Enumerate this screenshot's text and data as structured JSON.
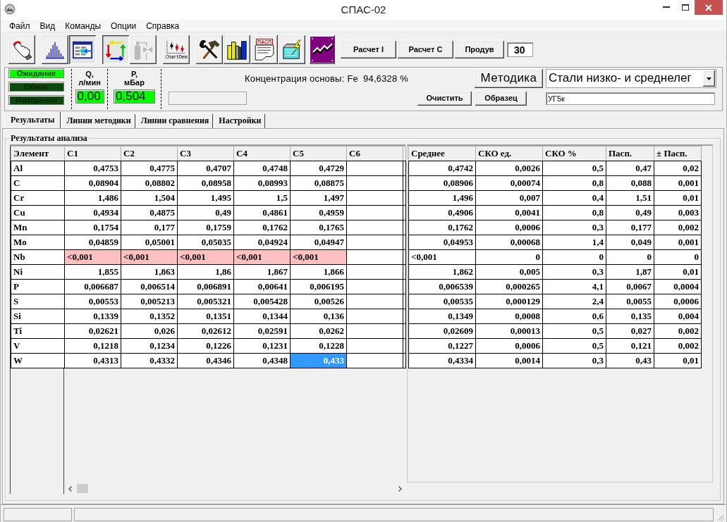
{
  "window": {
    "title": "СПАС-02"
  },
  "menu": [
    "Файл",
    "Вид",
    "Команды",
    "Опции",
    "Справка"
  ],
  "toolbar": {
    "groups": [
      [
        {
          "kind": "hand",
          "pressed": false,
          "disabled": false
        }
      ],
      [
        {
          "kind": "histogram",
          "pressed": false,
          "disabled": false
        },
        {
          "kind": "table",
          "pressed": true,
          "disabled": false
        }
      ],
      [
        {
          "kind": "arrows",
          "pressed": true,
          "disabled": false
        },
        {
          "kind": "cylinder",
          "pressed": false,
          "disabled": true
        }
      ],
      [
        {
          "kind": "chart",
          "caption": "ChartDem",
          "pressed": false,
          "disabled": false
        }
      ],
      [
        {
          "kind": "tools",
          "pressed": false,
          "disabled": false
        },
        {
          "kind": "books",
          "pressed": false,
          "disabled": false
        },
        {
          "kind": "document",
          "caption": "ПАСП",
          "pressed": false,
          "disabled": false
        },
        {
          "kind": "box",
          "pressed": false,
          "disabled": false
        }
      ],
      [
        {
          "kind": "trend",
          "pressed": false,
          "disabled": false
        }
      ]
    ],
    "buttons": [
      "Расчет I",
      "Расчет С",
      "Продув"
    ],
    "purge_time": "30"
  },
  "status": {
    "modes": [
      {
        "label": "Ожидание",
        "on": true
      },
      {
        "label": "Обжиг",
        "on": false
      },
      {
        "label": "Измерение",
        "on": false
      }
    ],
    "gauges": [
      {
        "label": "Q,\nл/мин",
        "value": "0,00"
      },
      {
        "label": "P,\nмБар",
        "value": "0,504"
      }
    ],
    "base_concentration": {
      "label": "Концентрация основы:",
      "element": "Fe",
      "value": "94,6328 %"
    },
    "method_button": "Методика",
    "method": "Стали низко- и среднелег",
    "buttons": [
      "Очистить",
      "Образец"
    ],
    "sample": "УГ5к"
  },
  "tabs": [
    {
      "label": "Результаты",
      "selected": true
    },
    {
      "label": "Линии методики",
      "selected": false
    },
    {
      "label": "Линии сравнения",
      "selected": false
    },
    {
      "label": "Настройки",
      "selected": false
    }
  ],
  "results": {
    "title": "Результаты анализа",
    "run_columns": [
      "Элемент",
      "C1",
      "C2",
      "C3",
      "C4",
      "C5",
      "C6"
    ],
    "stat_columns": [
      "Среднее",
      "СКО ед.",
      "СКО %",
      "Пасп.",
      "± Пасп."
    ],
    "rows": [
      {
        "element": "Al",
        "below_limit": false,
        "runs": [
          {
            "text": "0,4753",
            "selected": false
          },
          {
            "text": "0,4775",
            "selected": false
          },
          {
            "text": "0,4707",
            "selected": false
          },
          {
            "text": "0,4748",
            "selected": false
          },
          {
            "text": "0,4729",
            "selected": false
          }
        ],
        "stats": [
          "0,4742",
          "0,0026",
          "0,5",
          "0,47",
          "0,02"
        ]
      },
      {
        "element": "C",
        "below_limit": false,
        "runs": [
          {
            "text": "0,08904",
            "selected": false
          },
          {
            "text": "0,08802",
            "selected": false
          },
          {
            "text": "0,08958",
            "selected": false
          },
          {
            "text": "0,08993",
            "selected": false
          },
          {
            "text": "0,08875",
            "selected": false
          }
        ],
        "stats": [
          "0,08906",
          "0,00074",
          "0,8",
          "0,088",
          "0,001"
        ]
      },
      {
        "element": "Cr",
        "below_limit": false,
        "runs": [
          {
            "text": "1,486",
            "selected": false
          },
          {
            "text": "1,504",
            "selected": false
          },
          {
            "text": "1,495",
            "selected": false
          },
          {
            "text": "1,5",
            "selected": false
          },
          {
            "text": "1,497",
            "selected": false
          }
        ],
        "stats": [
          "1,496",
          "0,007",
          "0,4",
          "1,51",
          "0,01"
        ]
      },
      {
        "element": "Cu",
        "below_limit": false,
        "runs": [
          {
            "text": "0,4934",
            "selected": false
          },
          {
            "text": "0,4875",
            "selected": false
          },
          {
            "text": "0,49",
            "selected": false
          },
          {
            "text": "0,4861",
            "selected": false
          },
          {
            "text": "0,4959",
            "selected": false
          }
        ],
        "stats": [
          "0,4906",
          "0,0041",
          "0,8",
          "0,49",
          "0,003"
        ]
      },
      {
        "element": "Mn",
        "below_limit": false,
        "runs": [
          {
            "text": "0,1754",
            "selected": false
          },
          {
            "text": "0,177",
            "selected": false
          },
          {
            "text": "0,1759",
            "selected": false
          },
          {
            "text": "0,1762",
            "selected": false
          },
          {
            "text": "0,1765",
            "selected": false
          }
        ],
        "stats": [
          "0,1762",
          "0,0006",
          "0,3",
          "0,177",
          "0,002"
        ]
      },
      {
        "element": "Mo",
        "below_limit": false,
        "runs": [
          {
            "text": "0,04859",
            "selected": false
          },
          {
            "text": "0,05001",
            "selected": false
          },
          {
            "text": "0,05035",
            "selected": false
          },
          {
            "text": "0,04924",
            "selected": false
          },
          {
            "text": "0,04947",
            "selected": false
          }
        ],
        "stats": [
          "0,04953",
          "0,00068",
          "1,4",
          "0,049",
          "0,001"
        ]
      },
      {
        "element": "Nb",
        "below_limit": true,
        "runs": [
          {
            "text": "<0,001",
            "selected": false
          },
          {
            "text": "<0,001",
            "selected": false
          },
          {
            "text": "<0,001",
            "selected": false
          },
          {
            "text": "<0,001",
            "selected": false
          },
          {
            "text": "<0,001",
            "selected": false
          }
        ],
        "stats": [
          "<0,001",
          "0",
          "0",
          "0",
          "0"
        ]
      },
      {
        "element": "Ni",
        "below_limit": false,
        "runs": [
          {
            "text": "1,855",
            "selected": false
          },
          {
            "text": "1,863",
            "selected": false
          },
          {
            "text": "1,86",
            "selected": false
          },
          {
            "text": "1,867",
            "selected": false
          },
          {
            "text": "1,866",
            "selected": false
          }
        ],
        "stats": [
          "1,862",
          "0,005",
          "0,3",
          "1,87",
          "0,01"
        ]
      },
      {
        "element": "P",
        "below_limit": false,
        "runs": [
          {
            "text": "0,006687",
            "selected": false
          },
          {
            "text": "0,006514",
            "selected": false
          },
          {
            "text": "0,006891",
            "selected": false
          },
          {
            "text": "0,00641",
            "selected": false
          },
          {
            "text": "0,006195",
            "selected": false
          }
        ],
        "stats": [
          "0,006539",
          "0,000265",
          "4,1",
          "0,0067",
          "0,0004"
        ]
      },
      {
        "element": "S",
        "below_limit": false,
        "runs": [
          {
            "text": "0,00553",
            "selected": false
          },
          {
            "text": "0,005213",
            "selected": false
          },
          {
            "text": "0,005321",
            "selected": false
          },
          {
            "text": "0,005428",
            "selected": false
          },
          {
            "text": "0,00526",
            "selected": false
          }
        ],
        "stats": [
          "0,00535",
          "0,000129",
          "2,4",
          "0,0055",
          "0,0006"
        ]
      },
      {
        "element": "Si",
        "below_limit": false,
        "runs": [
          {
            "text": "0,1339",
            "selected": false
          },
          {
            "text": "0,1352",
            "selected": false
          },
          {
            "text": "0,1351",
            "selected": false
          },
          {
            "text": "0,1344",
            "selected": false
          },
          {
            "text": "0,136",
            "selected": false
          }
        ],
        "stats": [
          "0,1349",
          "0,0008",
          "0,6",
          "0,135",
          "0,004"
        ]
      },
      {
        "element": "Ti",
        "below_limit": false,
        "runs": [
          {
            "text": "0,02621",
            "selected": false
          },
          {
            "text": "0,026",
            "selected": false
          },
          {
            "text": "0,02612",
            "selected": false
          },
          {
            "text": "0,02591",
            "selected": false
          },
          {
            "text": "0,0262",
            "selected": false
          }
        ],
        "stats": [
          "0,02609",
          "0,00013",
          "0,5",
          "0,027",
          "0,002"
        ]
      },
      {
        "element": "V",
        "below_limit": false,
        "runs": [
          {
            "text": "0,1218",
            "selected": false
          },
          {
            "text": "0,1234",
            "selected": false
          },
          {
            "text": "0,1226",
            "selected": false
          },
          {
            "text": "0,1231",
            "selected": false
          },
          {
            "text": "0,1228",
            "selected": false
          }
        ],
        "stats": [
          "0,1227",
          "0,0006",
          "0,5",
          "0,121",
          "0,002"
        ]
      },
      {
        "element": "W",
        "below_limit": false,
        "runs": [
          {
            "text": "0,4313",
            "selected": false
          },
          {
            "text": "0,4332",
            "selected": false
          },
          {
            "text": "0,4346",
            "selected": false
          },
          {
            "text": "0,4348",
            "selected": false
          },
          {
            "text": "0,433",
            "selected": true
          }
        ],
        "stats": [
          "0,4334",
          "0,0014",
          "0,3",
          "0,43",
          "0,01"
        ]
      }
    ]
  }
}
